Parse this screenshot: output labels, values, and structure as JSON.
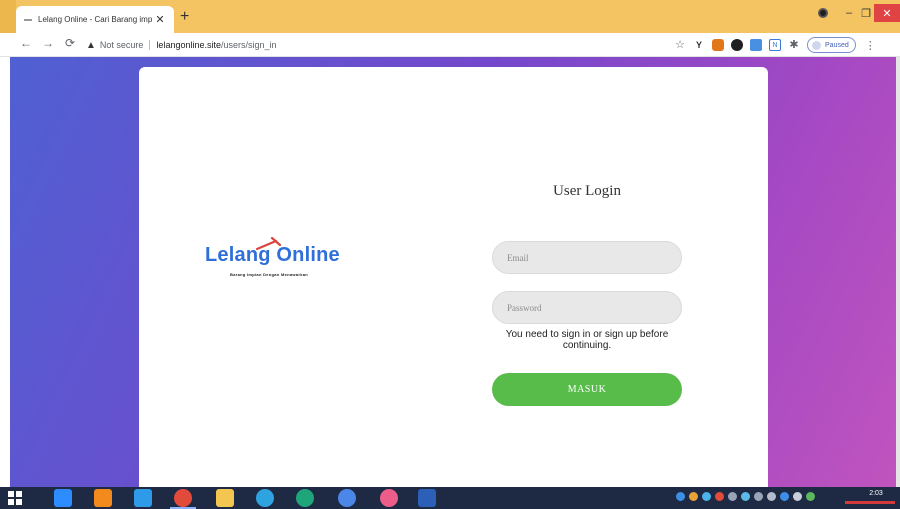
{
  "browser": {
    "tab_title": "Lelang Online - Cari Barang imp",
    "new_tab_symbol": "+",
    "close_tab_symbol": "✕",
    "window_controls": {
      "minimize": "–",
      "restore": "❐",
      "close": "✕"
    },
    "address": {
      "security_label": "Not secure",
      "host": "lelangonline.site",
      "path": "/users/sign_in"
    },
    "profile_status": "Paused",
    "extensions": [
      "star-icon",
      "y-extension-icon",
      "metamask-icon",
      "dark-circle-icon",
      "blue-square-icon",
      "code-extension-icon",
      "puzzle-icon"
    ]
  },
  "page": {
    "logo": {
      "text": "Lelang Online",
      "tagline": "Barang Impian Dengan Menawarkan"
    },
    "login": {
      "title": "User Login",
      "email_placeholder": "Email",
      "password_placeholder": "Password",
      "notice": "You need to sign in or sign up before continuing.",
      "submit_label": "MASUK"
    },
    "colors": {
      "button": "#58bc4a",
      "logo": "#2f6fd9",
      "gradient_start": "#4f60d2",
      "gradient_end": "#c054be"
    }
  },
  "taskbar": {
    "clock": "2:03",
    "apps": [
      "windows-start-icon",
      "zoom-icon",
      "sublime-icon",
      "vscode-icon",
      "chrome-icon",
      "file-explorer-icon",
      "telegram-icon",
      "edge-icon",
      "chrome-profile-icon",
      "itunes-icon",
      "word-icon"
    ]
  }
}
